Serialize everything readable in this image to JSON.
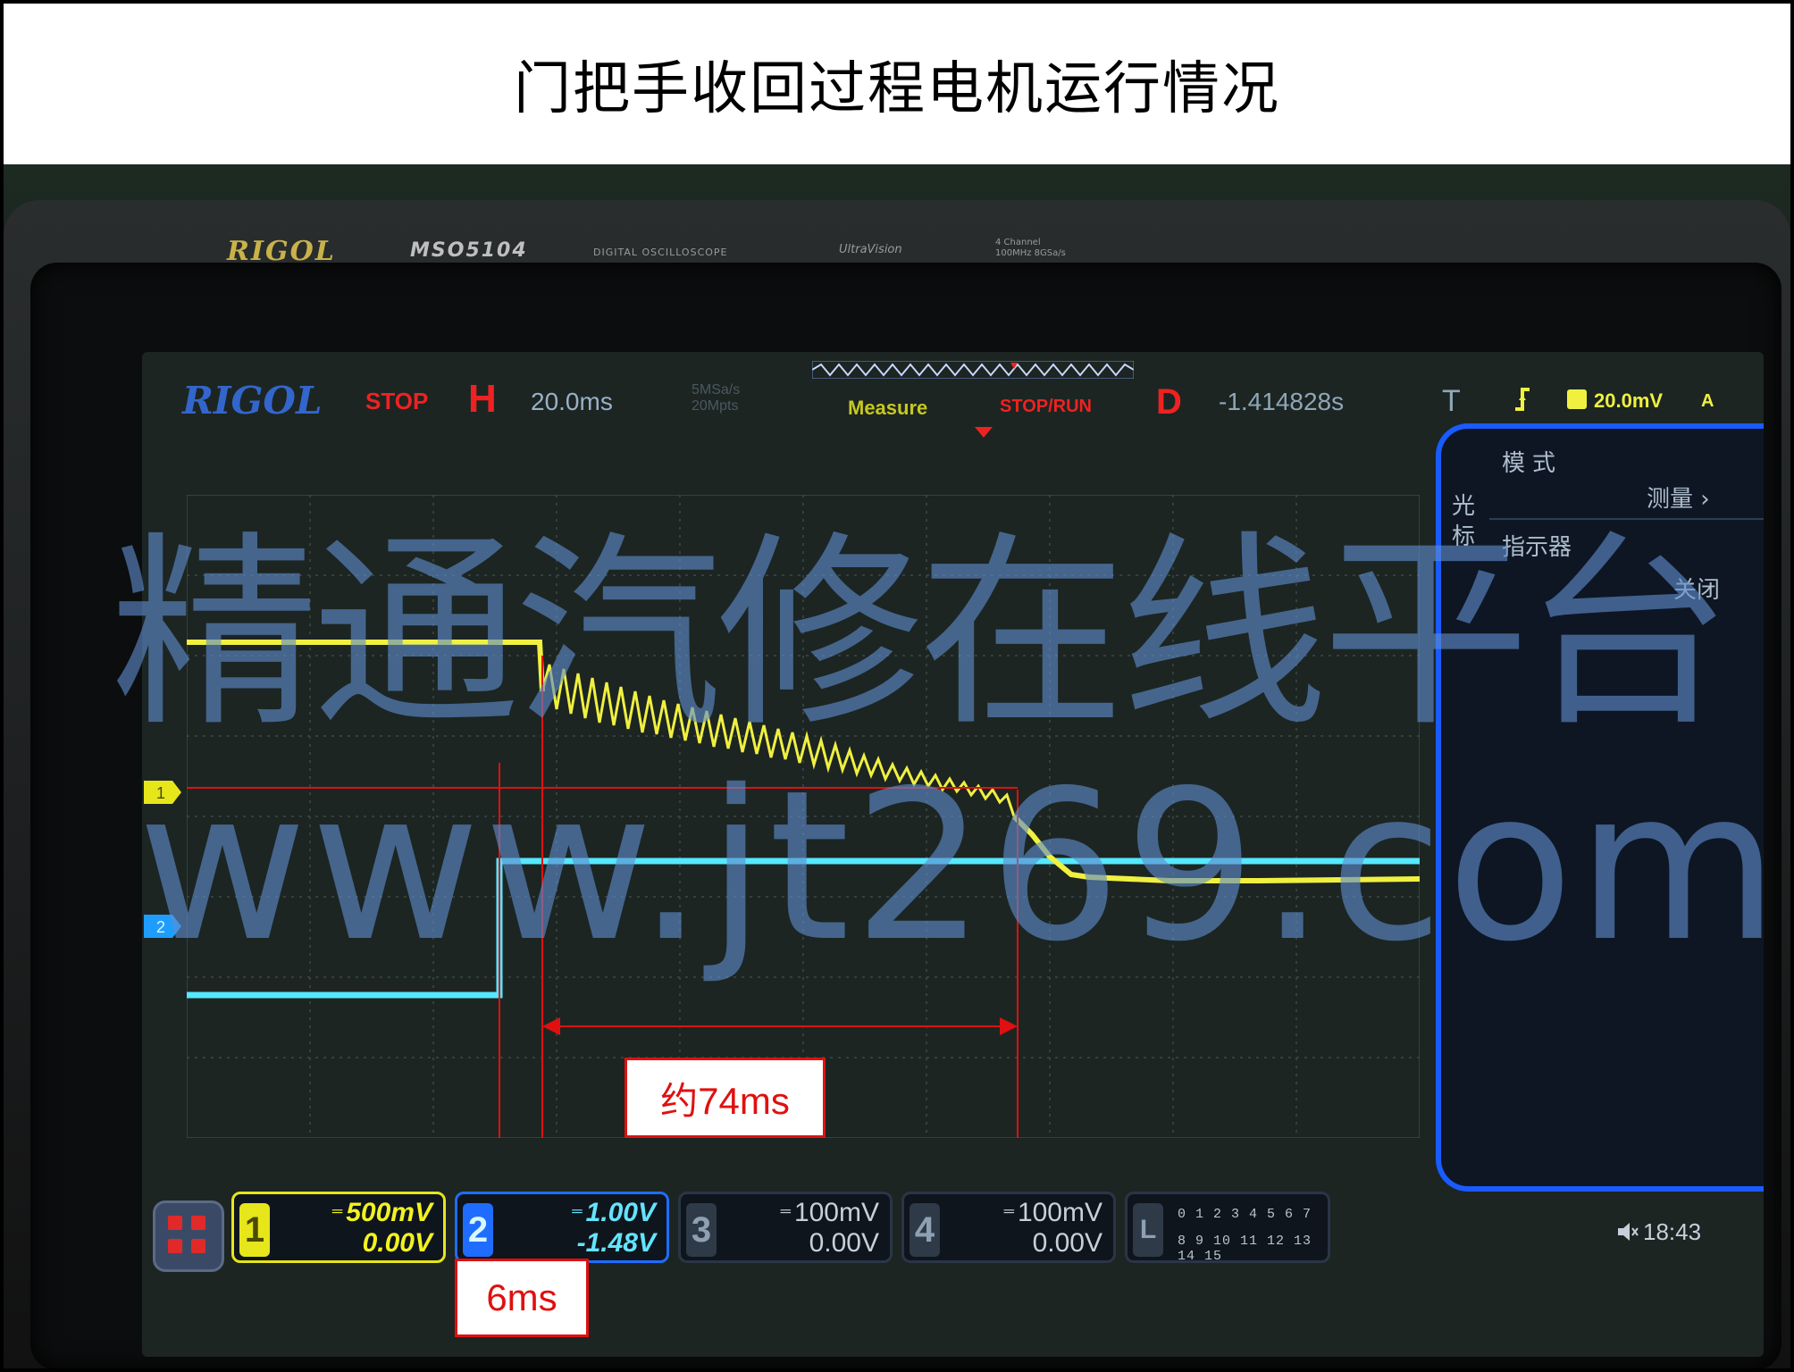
{
  "title": "门把手收回过程电机运行情况",
  "device": {
    "brand": "RIGOL",
    "model": "MSO5104",
    "description": "DIGITAL OSCILLOSCOPE",
    "brand2": "UltraVision",
    "specs": [
      "4 Channel",
      "100MHz 8GSa/s"
    ]
  },
  "status_bar": {
    "logo": "RIGOL",
    "run_state": "STOP",
    "horizontal_label": "H",
    "timebase": "20.0ms",
    "sample_rate": [
      "5MSa/s",
      "20Mpts"
    ],
    "measure_label": "Measure",
    "stop_run_label": "STOP/RUN",
    "delay_label": "D",
    "delay_value": "-1.414828s",
    "trigger_label": "T",
    "trigger_level": "20.0mV",
    "trigger_source": "A"
  },
  "side_menu": {
    "mode_label": "模式",
    "cursor_label": "光标",
    "measure_item": "测量",
    "indicator_label": "指示器",
    "close_item": "关闭"
  },
  "channels": [
    {
      "number": "1",
      "scale": "500mV",
      "offset": "0.00V",
      "color": "#e6e61a",
      "active": true
    },
    {
      "number": "2",
      "scale": "1.00V",
      "offset": "-1.48V",
      "color": "#1f6dff",
      "active": true
    },
    {
      "number": "3",
      "scale": "100mV",
      "offset": "0.00V",
      "color": "#8fa0b2",
      "active": false
    },
    {
      "number": "4",
      "scale": "100mV",
      "offset": "0.00V",
      "color": "#8fa0b2",
      "active": false
    }
  ],
  "logic_channel": {
    "label": "L",
    "row1": "0 1 2 3  4 5 6 7",
    "row2": "8 9 10 11 12 13 14 15"
  },
  "clock": "18:43",
  "annotations": {
    "duration_label": "约74ms",
    "delay_label": "6ms"
  },
  "watermark": {
    "line1": "精通汽修在线平台",
    "line2": "www.jt269.com"
  },
  "colors": {
    "ch1_trace": "#f0f040",
    "ch2_trace": "#55e8ff",
    "annotation": "#e01010",
    "menu_border": "#1a5bff"
  }
}
